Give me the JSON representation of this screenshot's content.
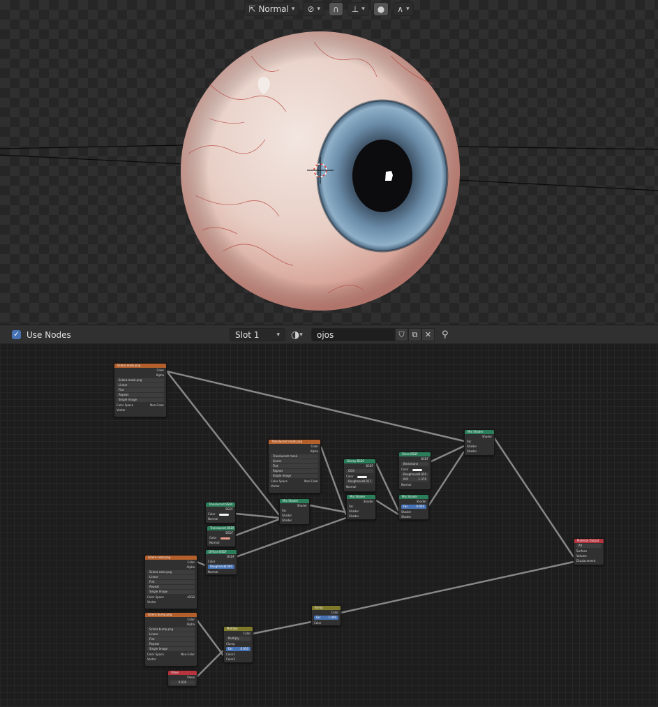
{
  "viewport": {
    "shading_mode": "Normal",
    "icons": [
      "transform-orientation-icon",
      "link-icon",
      "snap-icon",
      "snap-increment-icon",
      "proportional-edit-icon",
      "falloff-curve-icon"
    ]
  },
  "node_header": {
    "use_nodes_label": "Use Nodes",
    "use_nodes_checked": true,
    "slot": "Slot 1",
    "material_name": "ojos",
    "icons": [
      "material-sphere-icon",
      "fake-user-shield-icon",
      "duplicate-icon",
      "unlink-x-icon",
      "pin-icon"
    ]
  },
  "nodes": {
    "img1": {
      "title": "Sclera mask.png",
      "outputs": [
        "Color",
        "Alpha"
      ],
      "file": "Sclera mask.png",
      "rows": [
        "Linear",
        "Flat",
        "Repeat",
        "Single Image"
      ],
      "colorspace_label": "Color Space",
      "colorspace_value": "Non-Color",
      "input": "Vector"
    },
    "img2": {
      "title": "Translucent mask.png",
      "outputs": [
        "Color",
        "Alpha"
      ],
      "file": "Translucent mask",
      "rows": [
        "Linear",
        "Flat",
        "Repeat",
        "Single Image"
      ],
      "colorspace_label": "Color Space",
      "colorspace_value": "Non-Color",
      "input": "Vector"
    },
    "glossy1": {
      "title": "Glossy BSDF",
      "output": "BSDF",
      "dropdown": "GGX",
      "color_label": "Color",
      "roughness_label": "Roughness",
      "roughness_value": "0.027",
      "normal": "Normal"
    },
    "glossy2": {
      "title": "Glass BSDF",
      "output": "BSDF",
      "dropdown": "Beckmann",
      "color_label": "Color",
      "roughness_label": "Roughness",
      "roughness_value": "0.020",
      "ior_label": "IOR",
      "ior_value": "1.376",
      "normal": "Normal"
    },
    "mix_top": {
      "title": "Mix Shader",
      "output": "Shader",
      "inputs": [
        "Fac",
        "Shader",
        "Shader"
      ]
    },
    "trans1": {
      "title": "Translucent BSDF",
      "output": "BSDF",
      "color_label": "Color",
      "normal": "Normal"
    },
    "trans2": {
      "title": "Translucent BSDF",
      "output": "BSDF",
      "color_label": "Color",
      "normal": "Normal"
    },
    "diffuse": {
      "title": "Diffuse BSDF",
      "output": "BSDF",
      "color_label": "Color",
      "roughness_label": "Roughness",
      "roughness_value": "0.000",
      "normal": "Normal"
    },
    "mix1": {
      "title": "Mix Shader",
      "output": "Shader",
      "inputs": [
        "Fac",
        "Shader",
        "Shader"
      ]
    },
    "mix2": {
      "title": "Mix Shader",
      "output": "Shader",
      "inputs": [
        "Fac",
        "Shader",
        "Shader"
      ]
    },
    "mix3": {
      "title": "Mix Shader",
      "output": "Shader",
      "fac_value": "0.950",
      "inputs": [
        "Fac",
        "Shader",
        "Shader"
      ]
    },
    "img3": {
      "title": "Sclera color.png",
      "outputs": [
        "Color",
        "Alpha"
      ],
      "file": "Sclera color.png",
      "rows": [
        "Linear",
        "Flat",
        "Repeat",
        "Single Image"
      ],
      "colorspace_label": "Color Space",
      "colorspace_value": "sRGB",
      "input": "Vector"
    },
    "img4": {
      "title": "Sclera bump.png",
      "outputs": [
        "Color",
        "Alpha"
      ],
      "file": "Sclera bump.png",
      "rows": [
        "Linear",
        "Flat",
        "Repeat",
        "Single Image"
      ],
      "colorspace_label": "Color Space",
      "colorspace_value": "Non-Color",
      "input": "Vector"
    },
    "output": {
      "title": "Material Output",
      "dropdown": "All",
      "inputs": [
        "Surface",
        "Volume",
        "Displacement"
      ]
    },
    "bump": {
      "title": "Bump",
      "output": "Color",
      "inputs": [
        "Fac",
        "Color"
      ],
      "fac_value": "1.000"
    },
    "multiply": {
      "title": "Multiply",
      "output": "Color",
      "dropdown": "Multiply",
      "clamp": "Clamp",
      "fac_label": "Fac",
      "fac_value": "0.950",
      "inputs": [
        "Color1",
        "Color2"
      ]
    },
    "value": {
      "title": "Value",
      "output": "Value",
      "value": "0.030"
    }
  },
  "colors": {
    "shader_header": "#2a7e5a",
    "texture_header": "#b5602c",
    "output_header": "#b5343e",
    "converter_header": "#7e7a2a",
    "value_header": "#b5343e",
    "shader_socket": "#63c763",
    "color_socket": "#c7c729",
    "float_socket": "#a1a1a1",
    "vector_socket": "#6363c7"
  }
}
